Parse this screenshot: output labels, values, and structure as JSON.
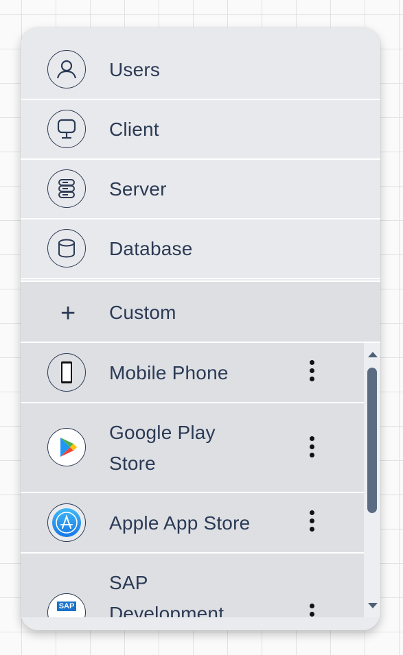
{
  "fixed_items": [
    {
      "label": "Users",
      "icon": "user-icon"
    },
    {
      "label": "Client",
      "icon": "monitor-icon"
    },
    {
      "label": "Server",
      "icon": "server-icon"
    },
    {
      "label": "Database",
      "icon": "database-icon"
    }
  ],
  "custom": {
    "label": "Custom",
    "icon": "plus-icon"
  },
  "custom_items": [
    {
      "label": "Mobile Phone",
      "icon": "mobile-phone-icon"
    },
    {
      "label_line1": "Google Play",
      "label_line2": "Store",
      "icon": "google-play-icon"
    },
    {
      "label": "Apple App Store",
      "icon": "app-store-icon"
    },
    {
      "label_line1": "SAP",
      "label_line2": "Development",
      "icon": "sap-icon",
      "icon_text": "SAP"
    }
  ],
  "colors": {
    "text": "#2b3a55",
    "panel_bg": "#e9ebee",
    "custom_bg": "#dddfe3",
    "scroll_thumb": "#5a6b82"
  }
}
